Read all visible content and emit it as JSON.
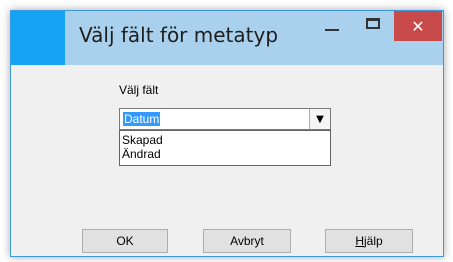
{
  "window": {
    "title": "Välj fält för metatyp",
    "close_glyph": "✕"
  },
  "form": {
    "field_label": "Välj fält",
    "combo_value": "Datum",
    "combo_arrow_glyph": "▼",
    "dropdown_options": [
      "Skapad",
      "Ändrad"
    ]
  },
  "buttons": {
    "ok": "OK",
    "cancel": "Avbryt",
    "help": "Hjälp"
  },
  "colors": {
    "app_icon": "#16a3f4",
    "titlebar": "#a9d1ee",
    "close_button": "#c94a4a",
    "selection": "#3399ff"
  },
  "icons": {
    "app": "app-icon",
    "minimize": "minimize-icon",
    "maximize": "maximize-icon",
    "close": "close-icon",
    "dropdown": "chevron-down-icon"
  }
}
